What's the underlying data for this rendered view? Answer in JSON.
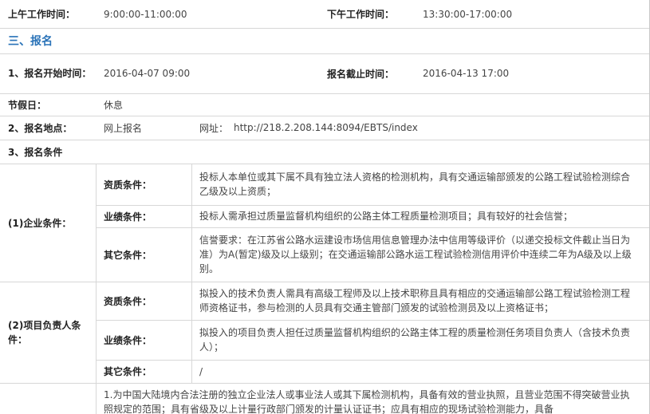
{
  "work_hours": {
    "am_label": "上午工作时间：",
    "am_value": "9:00:00-11:00:00",
    "pm_label": "下午工作时间：",
    "pm_value": "13:30:00-17:00:00"
  },
  "section_title": "三、报名",
  "signup": {
    "start_label": "1、报名开始时间：",
    "start_value": "2016-04-07 09:00",
    "end_label": "报名截止时间：",
    "end_value": "2016-04-13 17:00",
    "holiday_label": "节假日：",
    "holiday_value": "休息",
    "location_label": "2、报名地点：",
    "location_value": "网上报名",
    "url_label": "网址：",
    "url_value": "http://218.2.208.144:8094/EBTS/index",
    "conditions_label": "3、报名条件"
  },
  "company": {
    "label": "(1)企业条件：",
    "qual_label": "资质条件：",
    "qual_text": "投标人本单位或其下属不具有独立法人资格的检测机构，具有交通运输部颁发的公路工程试验检测综合乙级及以上资质；",
    "perf_label": "业绩条件：",
    "perf_text": "投标人需承担过质量监督机构组织的公路主体工程质量检测项目；具有较好的社会信誉；",
    "other_label": "其它条件：",
    "other_text": "信誉要求：在江苏省公路水运建设市场信用信息管理办法中信用等级评价（以递交投标文件截止当日为准）为A(暂定)级及以上级别；在交通运输部公路水运工程试验检测信用评价中连续二年为A级及以上级别。"
  },
  "manager": {
    "label": "(2)项目负责人条件：",
    "qual_label": "资质条件：",
    "qual_text": "拟投入的技术负责人需具有高级工程师及以上技术职称且具有相应的交通运输部公路工程试验检测工程师资格证书，参与检测的人员具有交通主管部门颁发的试验检测员及以上资格证书；",
    "perf_label": "业绩条件：",
    "perf_text": "拟投入的项目负责人担任过质量监督机构组织的公路主体工程的质量检测任务项目负责人（含技术负责人）；",
    "other_label": "其它条件：",
    "other_text": "/"
  },
  "footer_text": "1.为中国大陆境内合法注册的独立企业法人或事业法人或其下属检测机构，具备有效的营业执照，且营业范围不得突破营业执照规定的范围；具有省级及以上计量行政部门颁发的计量认证证书；应具有相应的现场试验检测能力，具备"
}
